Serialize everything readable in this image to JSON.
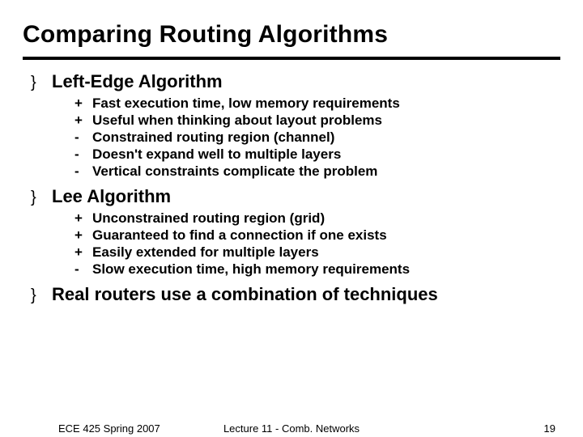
{
  "title": "Comparing Routing Algorithms",
  "bullet": "}",
  "sections": [
    {
      "title": "Left-Edge Algorithm",
      "items": [
        {
          "sign": "+",
          "text": "Fast execution time, low memory requirements"
        },
        {
          "sign": "+",
          "text": "Useful when thinking about layout problems"
        },
        {
          "sign": "-",
          "text": "Constrained routing region (channel)"
        },
        {
          "sign": "-",
          "text": "Doesn't expand well to multiple layers"
        },
        {
          "sign": "-",
          "text": "Vertical constraints complicate the problem"
        }
      ]
    },
    {
      "title": "Lee Algorithm",
      "items": [
        {
          "sign": "+",
          "text": "Unconstrained routing region (grid)"
        },
        {
          "sign": "+",
          "text": "Guaranteed to find a connection if one exists"
        },
        {
          "sign": "+",
          "text": "Easily extended for multiple layers"
        },
        {
          "sign": "-",
          "text": "Slow execution time, high memory requirements"
        }
      ]
    },
    {
      "title": "Real routers use a combination of techniques",
      "items": []
    }
  ],
  "footer": {
    "left": "ECE 425 Spring 2007",
    "center": "Lecture 11 - Comb. Networks",
    "right": "19"
  }
}
